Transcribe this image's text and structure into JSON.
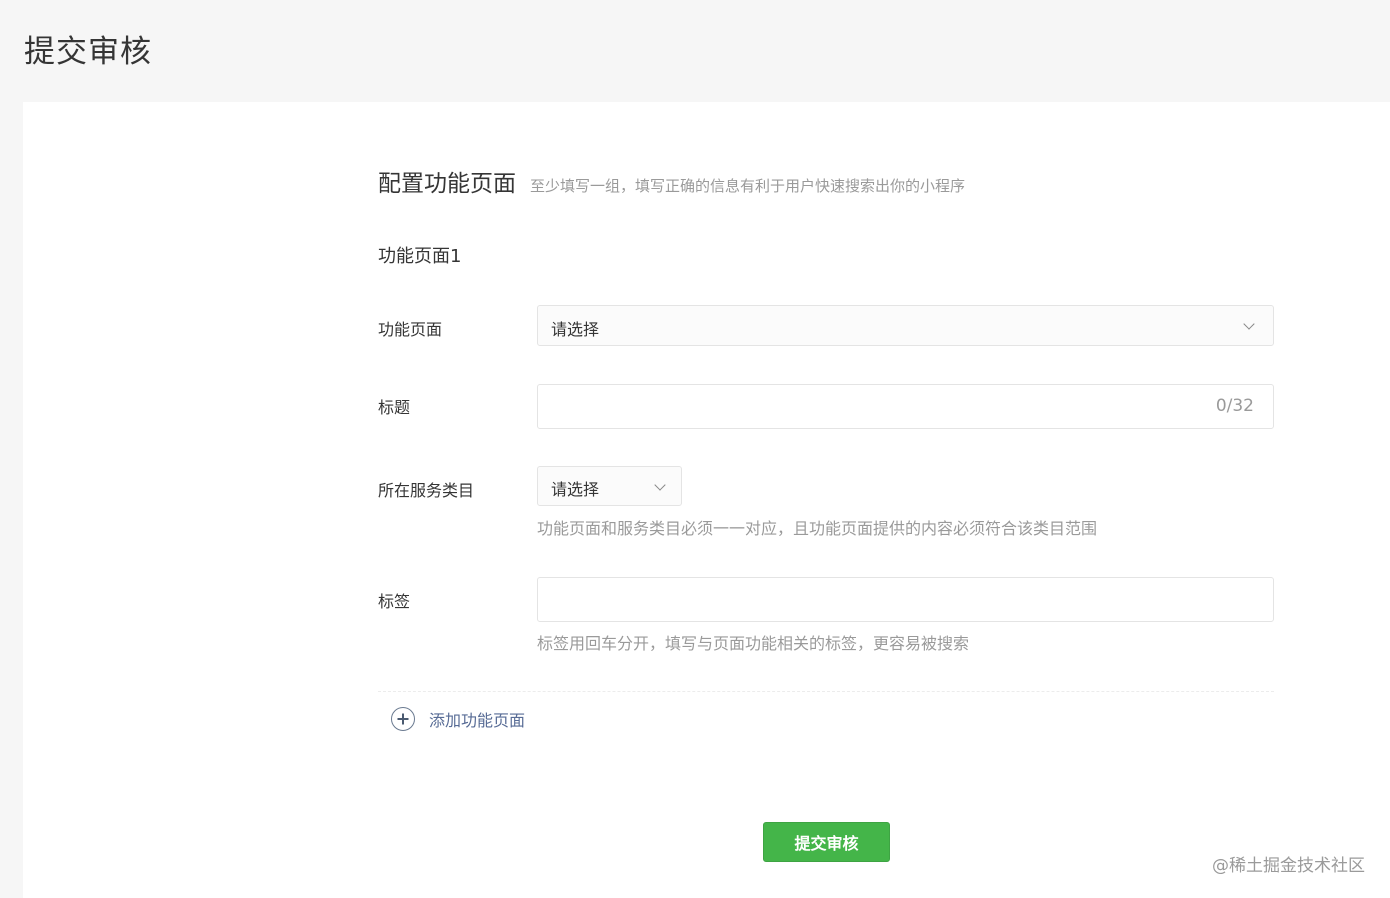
{
  "page_title": "提交审核",
  "section": {
    "title": "配置功能页面",
    "description": "至少填写一组，填写正确的信息有利于用户快速搜索出你的小程序"
  },
  "group_title": "功能页面1",
  "fields": {
    "function_page": {
      "label": "功能页面",
      "value": "请选择"
    },
    "title": {
      "label": "标题",
      "value": "",
      "counter": "0/32"
    },
    "category": {
      "label": "所在服务类目",
      "value": "请选择",
      "hint": "功能页面和服务类目必须一一对应，且功能页面提供的内容必须符合该类目范围"
    },
    "tags": {
      "label": "标签",
      "value": "",
      "hint": "标签用回车分开，填写与页面功能相关的标签，更容易被搜索"
    }
  },
  "add_page_label": "添加功能页面",
  "submit_label": "提交审核",
  "watermark": "@稀土掘金技术社区",
  "colors": {
    "primary_green": "#44b549",
    "link_blue": "#576b95",
    "hint_gray": "#9a9a9a"
  },
  "icons": {
    "dropdown": "chevron-down-icon",
    "add": "plus-circle-icon"
  }
}
